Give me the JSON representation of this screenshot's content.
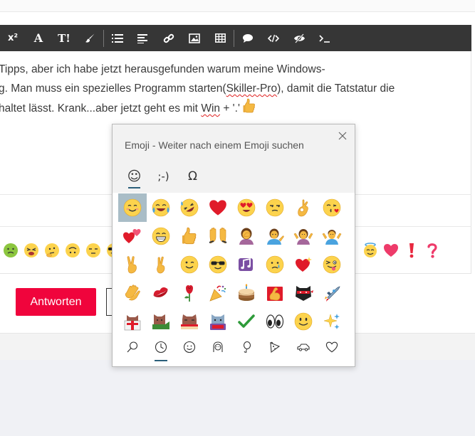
{
  "editor": {
    "line1": "Tipps, aber ich habe jetzt herausgefunden warum meine Windows-",
    "line2a": "g. Man muss ein spezielles Programm starten(",
    "line2b": "Skiller-Pro",
    "line2c": "), damit die Tatstatur die",
    "line3a": "haltet lässt. Krank...aber jetzt geht es mit ",
    "line3b": "Win",
    "line3c": " + '.'"
  },
  "toolbar": {
    "superscript": "x²",
    "font_label": "A",
    "text_size_label": "T!"
  },
  "actions": {
    "answer_label": "Antworten"
  },
  "picker": {
    "title": "Emoji - Weiter nach einem Emoji suchen",
    "tabs": [
      {
        "label": "☺"
      },
      {
        "label": ";-)"
      },
      {
        "label": "Ω"
      }
    ]
  },
  "emojis": {
    "grid": [
      "smiling-face",
      "face-with-tears-of-joy",
      "rolling-on-floor-laughing",
      "red-heart",
      "heart-eyes-face",
      "unamused-face",
      "ok-hand",
      "face-blowing-kiss",
      "two-hearts",
      "beaming-face",
      "thumbs-up",
      "raising-hands",
      "person-facepalming",
      "person-tipping-hand",
      "person-shrugging",
      "person-shrugging-blue",
      "victory-hand",
      "crossed-fingers",
      "winking-face",
      "sunglasses-face",
      "musical-notes",
      "crying-face",
      "sparkling-heart",
      "face-with-tongue",
      "clapping-hands",
      "kiss-mark",
      "rose",
      "party-popper",
      "birthday-cake",
      "flexed-biceps",
      "ninja-cat",
      "rocket-cat",
      "cat-box",
      "cat-green",
      "cat-lounging",
      "cat-hacker",
      "check-mark",
      "eyes",
      "grinning-face",
      "sparkles"
    ],
    "categories": [
      "search-icon",
      "recent-icon",
      "smileys-icon",
      "people-icon",
      "celebration-icon",
      "food-icon",
      "travel-icon",
      "heart-outline-icon"
    ],
    "reactions_left": [
      "nauseated-face",
      "tired-face",
      "thinking-face",
      "upside-down-face",
      "unamused-face",
      "sunglasses-face"
    ],
    "reactions_right": [
      "halo-face",
      "pink-heart",
      "red-exclamation",
      "pink-question"
    ]
  },
  "colors": {
    "toolbar_bg": "#363636",
    "answer_button": "#f0043c",
    "selection": "#a9bdc7",
    "accent": "#2b5f7a"
  }
}
